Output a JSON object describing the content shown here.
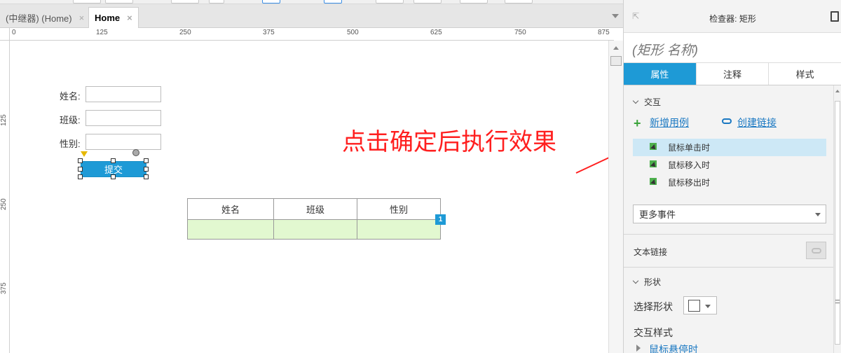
{
  "tabs": [
    {
      "label": "(中继器) (Home)",
      "close": "×"
    },
    {
      "label": "Home",
      "close": "×"
    }
  ],
  "ruler": {
    "h_labels": [
      "0",
      "125",
      "250",
      "375",
      "500",
      "625",
      "750",
      "875"
    ],
    "v_labels": [
      "125",
      "250",
      "375"
    ]
  },
  "form": {
    "name_label": "姓名:",
    "class_label": "班级:",
    "gender_label": "性别:",
    "submit_label": "提交"
  },
  "table": {
    "headers": [
      "姓名",
      "班级",
      "性别"
    ],
    "badge": "1"
  },
  "annotation": {
    "text": "点击确定后执行效果",
    "color": "#ff1f1f"
  },
  "inspector": {
    "title": "检查器: 矩形",
    "shape_name_placeholder": "(矩形 名称)",
    "tabs": [
      "属性",
      "注释",
      "样式"
    ],
    "interaction_section": "交互",
    "add_case": "新增用例",
    "create_link": "创建链接",
    "events": [
      "鼠标单击时",
      "鼠标移入时",
      "鼠标移出时"
    ],
    "more_events": "更多事件",
    "text_link": "文本链接",
    "shape_section": "形状",
    "select_shape": "选择形状",
    "interaction_style": "交互样式",
    "hover_link": "鼠标悬停时"
  },
  "colors": {
    "accent": "#1e9ad6",
    "row_fill": "#e2f8d0",
    "link": "#1a78c2"
  }
}
